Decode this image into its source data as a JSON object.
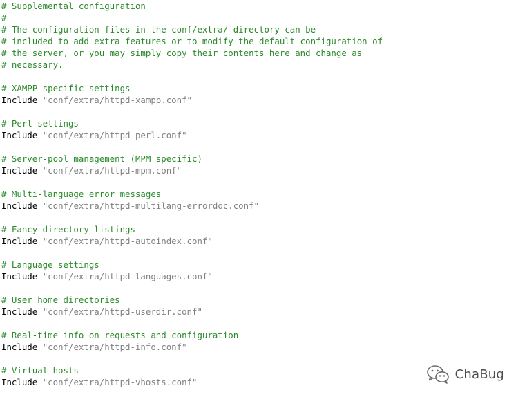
{
  "code": {
    "lines": [
      {
        "type": "comment",
        "text": "# Supplemental configuration"
      },
      {
        "type": "comment",
        "text": "#"
      },
      {
        "type": "comment",
        "text": "# The configuration files in the conf/extra/ directory can be"
      },
      {
        "type": "comment",
        "text": "# included to add extra features or to modify the default configuration of"
      },
      {
        "type": "comment",
        "text": "# the server, or you may simply copy their contents here and change as"
      },
      {
        "type": "comment",
        "text": "# necessary."
      },
      {
        "type": "blank",
        "text": ""
      },
      {
        "type": "comment",
        "text": "# XAMPP specific settings"
      },
      {
        "type": "include",
        "keyword": "Include",
        "value": "\"conf/extra/httpd-xampp.conf\""
      },
      {
        "type": "blank",
        "text": ""
      },
      {
        "type": "comment",
        "text": "# Perl settings"
      },
      {
        "type": "include",
        "keyword": "Include",
        "value": "\"conf/extra/httpd-perl.conf\""
      },
      {
        "type": "blank",
        "text": ""
      },
      {
        "type": "comment",
        "text": "# Server-pool management (MPM specific)"
      },
      {
        "type": "include",
        "keyword": "Include",
        "value": "\"conf/extra/httpd-mpm.conf\""
      },
      {
        "type": "blank",
        "text": ""
      },
      {
        "type": "comment",
        "text": "# Multi-language error messages"
      },
      {
        "type": "include",
        "keyword": "Include",
        "value": "\"conf/extra/httpd-multilang-errordoc.conf\""
      },
      {
        "type": "blank",
        "text": ""
      },
      {
        "type": "comment",
        "text": "# Fancy directory listings"
      },
      {
        "type": "include",
        "keyword": "Include",
        "value": "\"conf/extra/httpd-autoindex.conf\""
      },
      {
        "type": "blank",
        "text": ""
      },
      {
        "type": "comment",
        "text": "# Language settings"
      },
      {
        "type": "include",
        "keyword": "Include",
        "value": "\"conf/extra/httpd-languages.conf\""
      },
      {
        "type": "blank",
        "text": ""
      },
      {
        "type": "comment",
        "text": "# User home directories"
      },
      {
        "type": "include",
        "keyword": "Include",
        "value": "\"conf/extra/httpd-userdir.conf\""
      },
      {
        "type": "blank",
        "text": ""
      },
      {
        "type": "comment",
        "text": "# Real-time info on requests and configuration"
      },
      {
        "type": "include",
        "keyword": "Include",
        "value": "\"conf/extra/httpd-info.conf\""
      },
      {
        "type": "blank",
        "text": ""
      },
      {
        "type": "comment",
        "text": "# Virtual hosts"
      },
      {
        "type": "include",
        "keyword": "Include",
        "value": "\"conf/extra/httpd-vhosts.conf\""
      }
    ]
  },
  "watermark": {
    "icon": "wechat-icon",
    "text": "ChaBug"
  },
  "colors": {
    "comment": "#2a8a2a",
    "keyword": "#000000",
    "string": "#808080",
    "background": "#ffffff"
  }
}
